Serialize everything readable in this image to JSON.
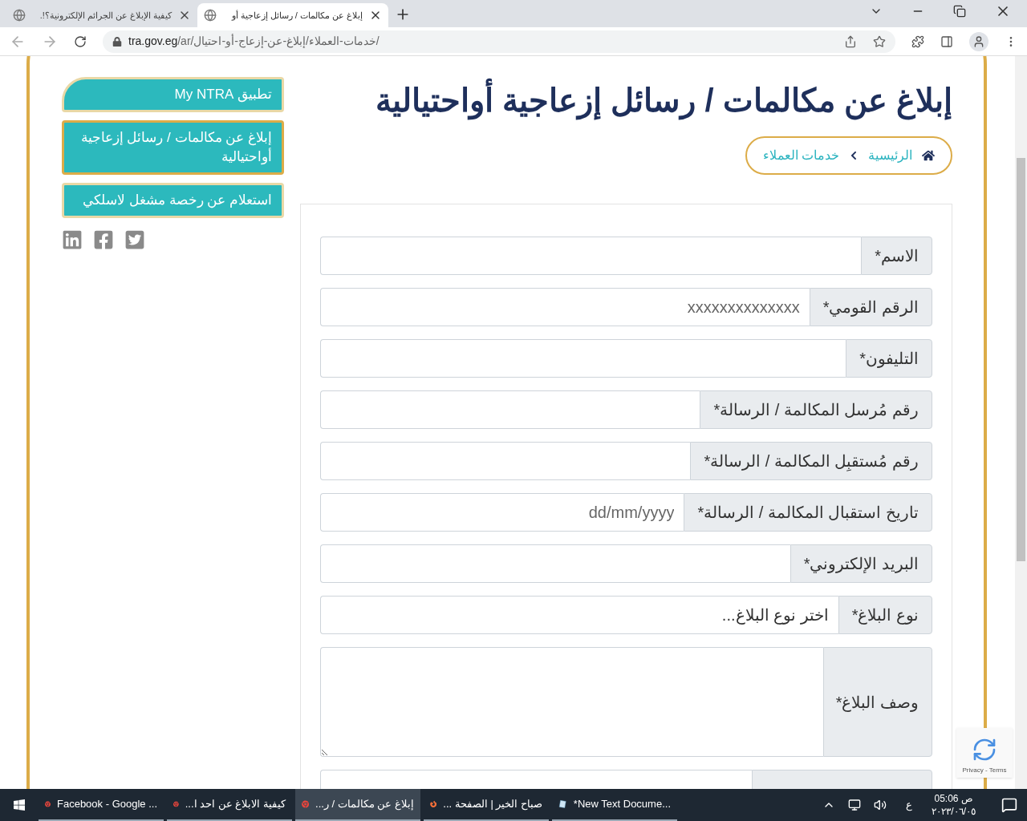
{
  "browser": {
    "tabs": [
      {
        "title": "إبلاغ عن مكالمات / رسائل إزعاجية أو",
        "selected": true
      },
      {
        "title": "كيفية الإبلاغ عن الجرائم الإلكترونية؟!.",
        "selected": false
      }
    ],
    "address": {
      "host": "tra.gov.eg",
      "path": "/ar/خدمات-العملاء/إبلاغ-عن-إزعاج-أو-احتيال/"
    }
  },
  "page": {
    "title": "إبلاغ عن مكالمات / رسائل إزعاجية أواحتيالية",
    "breadcrumb": [
      "الرئيسية",
      "خدمات العملاء"
    ],
    "sidebar": [
      {
        "label": "تطبيق My NTRA",
        "selected": false
      },
      {
        "label": "إبلاغ عن مكالمات / رسائل إزعاجية أواحتيالية",
        "selected": true
      },
      {
        "label": "استعلام عن رخصة مشغل لاسلكي",
        "selected": false
      }
    ],
    "form": [
      {
        "kind": "text",
        "label": "الاسم*"
      },
      {
        "kind": "text",
        "label": "الرقم القومي*",
        "placeholder": "xxxxxxxxxxxxxx"
      },
      {
        "kind": "text",
        "label": "التليفون*"
      },
      {
        "kind": "text",
        "label": "رقم مُرسل المكالمة / الرسالة*"
      },
      {
        "kind": "text",
        "label": "رقم مُستقبِل المكالمة / الرسالة*"
      },
      {
        "kind": "date",
        "label": "تاريخ استقبال المكالمة / الرسالة*",
        "placeholder": "dd/mm/yyyy"
      },
      {
        "kind": "text",
        "label": "البريد الإلكتروني*"
      },
      {
        "kind": "select",
        "label": "نوع البلاغ*",
        "value": "اختر نوع البلاغ..."
      },
      {
        "kind": "textarea",
        "label": "وصف البلاغ*"
      },
      {
        "kind": "blank"
      }
    ],
    "recaptcha": "Privacy - Terms"
  },
  "taskbar": {
    "items": [
      {
        "kind": "notepad",
        "label": "*New Text Docume...",
        "selected": false
      },
      {
        "kind": "firefox",
        "label": "صباح الخير | الصفحة ...",
        "selected": false
      },
      {
        "kind": "chrome",
        "label": "إبلاغ عن مكالمات / ر...",
        "selected": true
      },
      {
        "kind": "chrome",
        "label": "كيفية الابلاغ عن احد ا...",
        "selected": false
      },
      {
        "kind": "chrome",
        "label": "Facebook - Google ...",
        "selected": false
      }
    ],
    "language": "ع",
    "time": "05:06 ص",
    "date": "٢٠٢٣/٠٦/٠٥"
  }
}
